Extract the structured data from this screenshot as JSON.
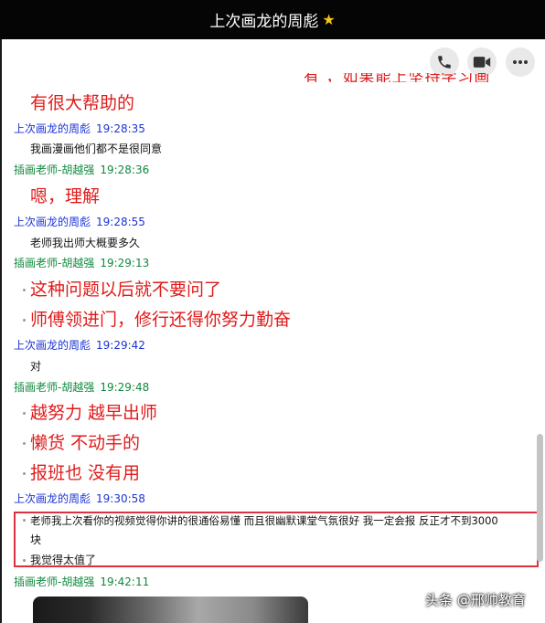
{
  "window": {
    "title": "上次画龙的周彪",
    "title_badge": "star-icon"
  },
  "toolbar": {
    "buttons": [
      "phone-icon",
      "video-icon",
      "more-icon"
    ]
  },
  "chat": {
    "cut_off_text": "有 ，如果能上坚持学习画",
    "messages": [
      {
        "kind": "big",
        "text": "有很大帮助的"
      },
      {
        "kind": "header",
        "sender": "上次画龙的周彪",
        "time": "19:28:35",
        "role": "me"
      },
      {
        "kind": "small",
        "text": "我画漫画他们都不是很同意"
      },
      {
        "kind": "header",
        "sender": "插画老师-胡越强",
        "time": "19:28:36",
        "role": "teacher"
      },
      {
        "kind": "big",
        "text": "嗯，理解"
      },
      {
        "kind": "header",
        "sender": "上次画龙的周彪",
        "time": "19:28:55",
        "role": "me"
      },
      {
        "kind": "small",
        "text": "老师我出师大概要多久"
      },
      {
        "kind": "header",
        "sender": "插画老师-胡越强",
        "time": "19:29:13",
        "role": "teacher"
      },
      {
        "kind": "big",
        "text": "这种问题以后就不要问了"
      },
      {
        "kind": "big",
        "text": "师傅领进门，修行还得你努力勤奋"
      },
      {
        "kind": "header",
        "sender": "上次画龙的周彪",
        "time": "19:29:42",
        "role": "me"
      },
      {
        "kind": "small",
        "text": "对"
      },
      {
        "kind": "header",
        "sender": "插画老师-胡越强",
        "time": "19:29:48",
        "role": "teacher"
      },
      {
        "kind": "big",
        "text": "越努力 越早出师"
      },
      {
        "kind": "big",
        "text": "懒货 不动手的"
      },
      {
        "kind": "big",
        "text": "报班也 没有用"
      },
      {
        "kind": "header",
        "sender": "上次画龙的周彪",
        "time": "19:30:58",
        "role": "me"
      },
      {
        "kind": "small",
        "text": "老师我上次看你的视频觉得你讲的很通俗易懂  而且很幽默课堂气氛很好  我一定会报  反正才不到3000"
      },
      {
        "kind": "small",
        "text": "块"
      },
      {
        "kind": "small",
        "text": "我觉得太值了"
      },
      {
        "kind": "header",
        "sender": "插画老师-胡越强",
        "time": "19:42:11",
        "role": "teacher"
      }
    ]
  },
  "watermark": "头条 @邢帅教育",
  "colors": {
    "title_bar": "#050505",
    "sender_me": "#1b33d6",
    "sender_teacher": "#108a3e",
    "big_text": "#e01b1b",
    "highlight_border": "#e03040"
  }
}
